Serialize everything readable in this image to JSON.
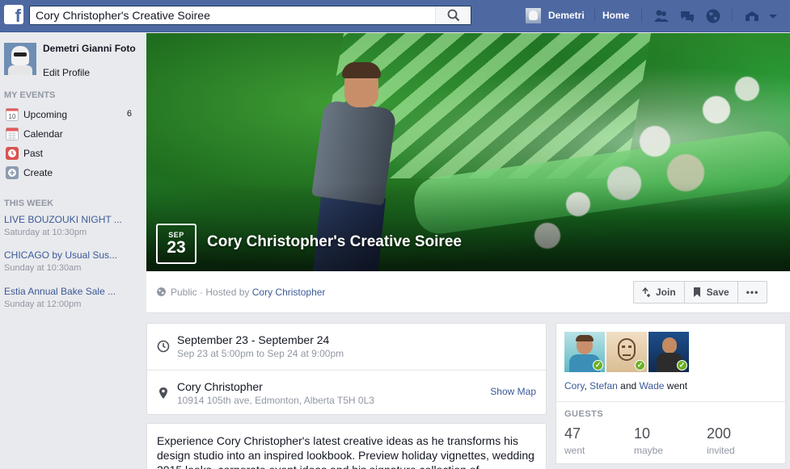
{
  "topbar": {
    "logo": "f",
    "search_value": "Cory Christopher's Creative Soiree",
    "user_name": "Demetri",
    "home_label": "Home"
  },
  "sidebar": {
    "profile_name": "Demetri Gianni Foto",
    "edit_profile": "Edit Profile",
    "my_events_header": "MY EVENTS",
    "items": [
      {
        "label": "Upcoming",
        "count": "6",
        "icon": "calendar-10-icon",
        "icon_text": "10"
      },
      {
        "label": "Calendar",
        "count": "",
        "icon": "calendar-grid-icon"
      },
      {
        "label": "Past",
        "count": "",
        "icon": "clock-icon"
      },
      {
        "label": "Create",
        "count": "",
        "icon": "plus-circle-icon"
      }
    ],
    "this_week_header": "THIS WEEK",
    "week_events": [
      {
        "title": "LIVE BOUZOUKI NIGHT ...",
        "time": "Saturday at 10:30pm"
      },
      {
        "title": "CHICAGO by Usual Sus...",
        "time": "Sunday at 10:30am"
      },
      {
        "title": "Estia Annual Bake Sale ...",
        "time": "Sunday at 12:00pm"
      }
    ]
  },
  "event": {
    "month": "SEP",
    "day": "23",
    "title": "Cory Christopher's Creative Soiree",
    "privacy": "Public · Hosted by",
    "host": "Cory Christopher",
    "actions": {
      "join": "Join",
      "save": "Save",
      "more": "•••"
    },
    "date_main": "September 23 - September 24",
    "date_sub": "Sep 23 at 5:00pm to Sep 24 at 9:00pm",
    "location_name": "Cory Christopher",
    "location_address": "10914 105th ave, Edmonton, Alberta T5H 0L3",
    "show_map": "Show Map",
    "description": "Experience Cory Christopher's latest creative ideas as he transforms his design studio into an inspired lookbook. Preview holiday vignettes, wedding 2015 looks, corporate event ideas and his signature collection of"
  },
  "guests": {
    "went_names": [
      "Cory",
      "Stefan",
      "Wade"
    ],
    "went_sep1": ", ",
    "went_sep2": " and ",
    "went_suffix": " went",
    "header": "GUESTS",
    "stats": [
      {
        "number": "47",
        "label": "went"
      },
      {
        "number": "10",
        "label": "maybe"
      },
      {
        "number": "200",
        "label": "invited"
      }
    ]
  },
  "colors": {
    "topbar": "#4e69a2",
    "link": "#3b5998",
    "muted": "#9197a3",
    "page_bg": "#e9eaed",
    "check_green": "#6bb026"
  }
}
